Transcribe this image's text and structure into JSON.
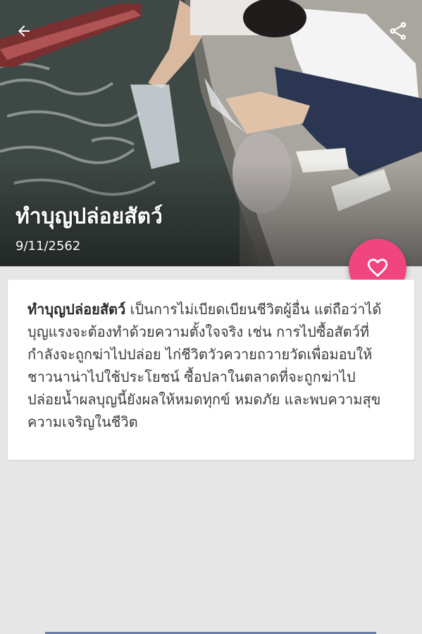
{
  "header": {
    "title": "ทำบุญปล่อยสัตว์",
    "date": "9/11/2562",
    "back_icon": "back-arrow-icon",
    "share_icon": "share-icon"
  },
  "favorite": {
    "icon": "heart-outline-icon",
    "color": "#f0457e"
  },
  "article": {
    "lead": "ทำบุญปล่อยสัตว์",
    "body": " เป็นการไม่เบียดเบียนชีวิตผู้อื่น แต่ถือว่าได้บุญแรงจะต้องทำด้วยความตั้งใจจริง เช่น การไปซื้อสัตว์ที่กำลังจะถูกฆ่าไปปล่อย ไก่ชีวิตวัวควายถวายวัดเพื่อมอบให้ชาวนาน่าไปใช้ประโยชน์ ซื้อปลาในตลาดที่จะถูกฆ่าไปปล่อยน้ำผลบุญนี้ยังผลให้หมดทุกข์ หมดภัย และพบความสุขความเจริญในชีวิต"
  }
}
